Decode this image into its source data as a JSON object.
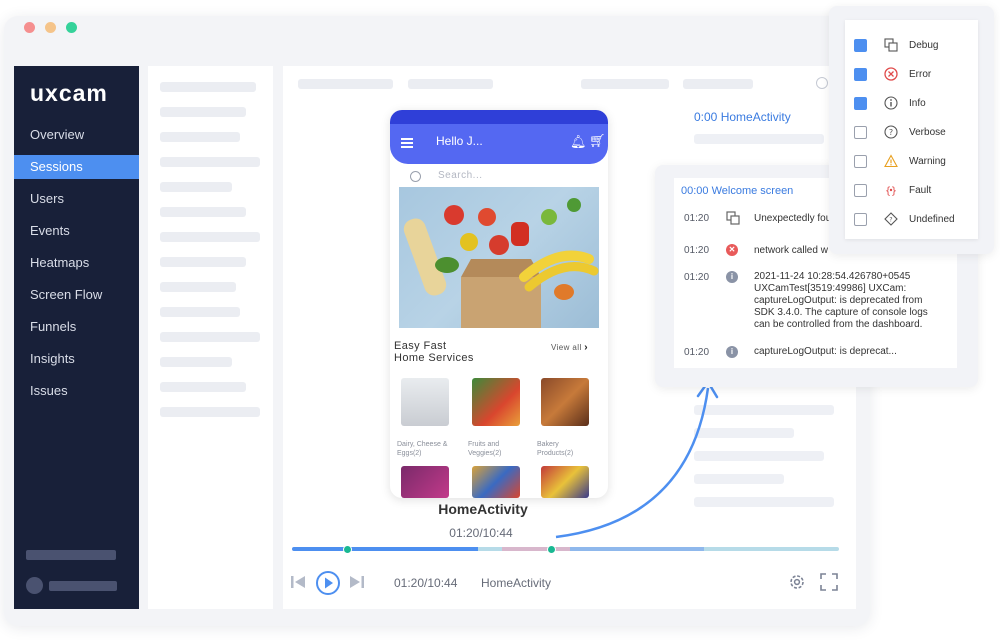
{
  "app": {
    "logo": "uxcam"
  },
  "sidebar": {
    "items": [
      {
        "label": "Overview"
      },
      {
        "label": "Sessions",
        "active": true
      },
      {
        "label": "Users"
      },
      {
        "label": "Events"
      },
      {
        "label": "Heatmaps"
      },
      {
        "label": "Screen Flow"
      },
      {
        "label": "Funnels"
      },
      {
        "label": "Insights"
      },
      {
        "label": "Issues"
      }
    ]
  },
  "phone": {
    "greeting": "Hello J...",
    "search_placeholder": "Search...",
    "section_title_1": "Easy Fast",
    "section_title_2": "Home Services",
    "view_all": "View all",
    "categories": [
      {
        "label": "Dairy, Cheese &\nEggs(2)"
      },
      {
        "label": "Fruits and\nVeggies(2)"
      },
      {
        "label": "Bakery\nProducts(2)"
      }
    ]
  },
  "player": {
    "activity": "HomeActivity",
    "timestamp": "01:20/10:44",
    "control_time": "01:20/10:44",
    "control_activity": "HomeActivity",
    "progress": 0.45
  },
  "log_panel": {
    "behind_title": "0:00 HomeActivity",
    "title": "00:00 Welcome screen",
    "entries": [
      {
        "time": "01:20",
        "icon": "debug-icon",
        "text": "Unexpectedly fou"
      },
      {
        "time": "01:20",
        "icon": "error-icon",
        "text": "network called w"
      },
      {
        "time": "01:20",
        "icon": "info-icon",
        "text": "2021-11-24 10:28:54.426780+0545\nUXCamTest[3519:49986] UXCam:\ncaptureLogOutput: is deprecated from\nSDK 3.4.0. The capture of console logs\ncan be controlled from the dashboard."
      },
      {
        "time": "01:20",
        "icon": "info-icon",
        "text": "captureLogOutput: is deprecat..."
      }
    ]
  },
  "log_filters": [
    {
      "label": "Debug",
      "checked": true,
      "icon": "debug-icon"
    },
    {
      "label": "Error",
      "checked": true,
      "icon": "error-icon"
    },
    {
      "label": "Info",
      "checked": true,
      "icon": "info-icon"
    },
    {
      "label": "Verbose",
      "checked": false,
      "icon": "verbose-icon"
    },
    {
      "label": "Warning",
      "checked": false,
      "icon": "warning-icon"
    },
    {
      "label": "Fault",
      "checked": false,
      "icon": "fault-icon"
    },
    {
      "label": "Undefined",
      "checked": false,
      "icon": "undefined-icon"
    }
  ],
  "colors": {
    "accent": "#4d8ff0",
    "sidebar_bg": "#182039",
    "phone_header": "#5468f2",
    "error": "#e85a5a",
    "info": "#8a93a6",
    "knob": "#19b892"
  }
}
